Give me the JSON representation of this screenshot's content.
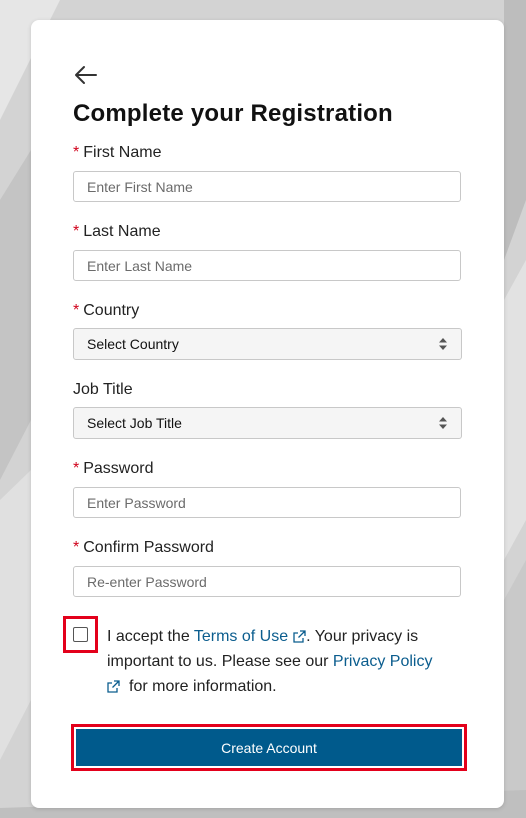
{
  "form": {
    "title": "Complete your Registration",
    "required_marker": "*",
    "fields": {
      "first_name": {
        "label": "First Name",
        "placeholder": "Enter First Name",
        "value": ""
      },
      "last_name": {
        "label": "Last Name",
        "placeholder": "Enter Last Name",
        "value": ""
      },
      "country": {
        "label": "Country",
        "selected": "Select Country"
      },
      "job_title": {
        "label": "Job Title",
        "selected": "Select Job Title"
      },
      "password": {
        "label": "Password",
        "placeholder": "Enter Password",
        "value": ""
      },
      "confirm_password": {
        "label": "Confirm Password",
        "placeholder": "Re-enter Password",
        "value": ""
      }
    },
    "consent": {
      "checked": false,
      "text_1": "I accept the ",
      "terms_link": "Terms of Use",
      "text_2": ". Your privacy is important to us. Please see our ",
      "privacy_link": "Privacy Policy",
      "text_3": "for more information."
    },
    "submit_label": "Create Account"
  },
  "icons": {
    "back": "arrow-left-icon",
    "select_caret": "sort-caret-icon",
    "external": "external-link-icon"
  },
  "colors": {
    "accent": "#005a8c",
    "link": "#0b5d8e",
    "required": "#d0021b",
    "highlight": "#e3001b"
  }
}
